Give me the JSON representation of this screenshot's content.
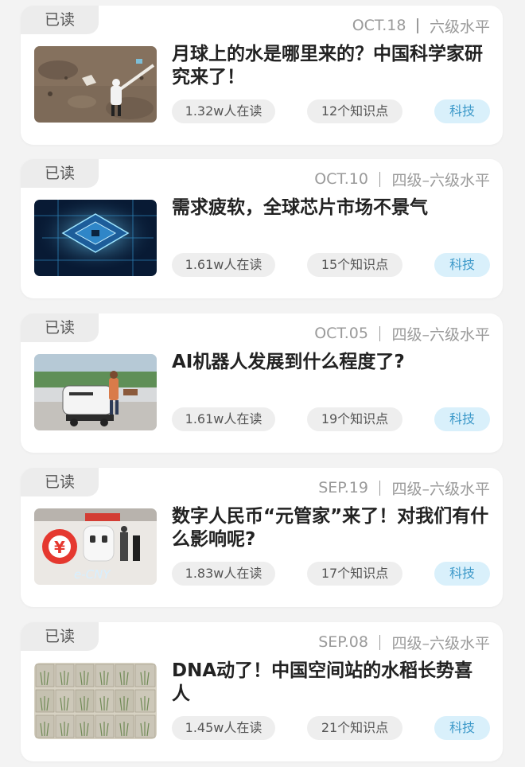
{
  "articles": [
    {
      "read_badge": "已读",
      "date": "OCT.18",
      "level": "六级水平",
      "title": "月球上的水是哪里来的？中国科学家研究来了！",
      "readers": "1.32w人在读",
      "knowledge_points": "12个知识点",
      "tag": "科技",
      "image": "moon-scene"
    },
    {
      "read_badge": "已读",
      "date": "OCT.10",
      "level": "四级–六级水平",
      "title": "需求疲软，全球芯片市场不景气",
      "readers": "1.61w人在读",
      "knowledge_points": "15个知识点",
      "tag": "科技",
      "image": "chip-scene"
    },
    {
      "read_badge": "已读",
      "date": "OCT.05",
      "level": "四级–六级水平",
      "title": "AI机器人发展到什么程度了?",
      "readers": "1.61w人在读",
      "knowledge_points": "19个知识点",
      "tag": "科技",
      "image": "robot-scene"
    },
    {
      "read_badge": "已读",
      "date": "SEP.19",
      "level": "四级–六级水平",
      "title": "数字人民币“元管家”来了！对我们有什么影响呢?",
      "readers": "1.83w人在读",
      "knowledge_points": "17个知识点",
      "tag": "科技",
      "image": "ecny-scene"
    },
    {
      "read_badge": "已读",
      "date": "SEP.08",
      "level": "四级–六级水平",
      "title": "DNA动了！中国空间站的水稻长势喜人",
      "readers": "1.45w人在读",
      "knowledge_points": "21个知识点",
      "tag": "科技",
      "image": "rice-scene"
    }
  ],
  "thumb_labels": {
    "ecny": "e-CNY"
  },
  "colors": {
    "page_background": "#f3f3f3",
    "card_background": "#ffffff",
    "tag_background": "#d9f0fb",
    "tag_text": "#3d99c9"
  }
}
